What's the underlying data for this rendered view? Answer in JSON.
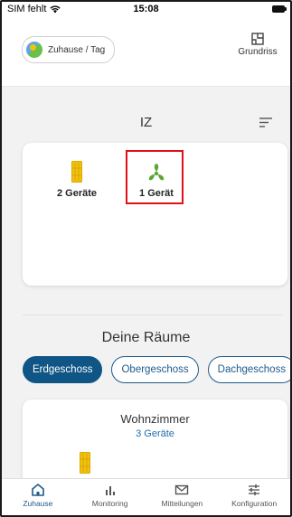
{
  "status": {
    "carrier": "SIM fehlt",
    "time": "15:08"
  },
  "header": {
    "home_label": "Zuhause / Tag",
    "grundriss_label": "Grundriss"
  },
  "area": {
    "title": "IZ"
  },
  "devices": [
    {
      "label": "2 Geräte",
      "icon": "heater-icon",
      "color": "#f2c10f"
    },
    {
      "label": "1 Gerät",
      "icon": "fan-icon",
      "color": "#5aa832"
    }
  ],
  "rooms": {
    "title": "Deine Räume",
    "tabs": [
      "Erdgeschoss",
      "Obergeschoss",
      "Dachgeschoss"
    ],
    "active_tab": "Erdgeschoss",
    "card": {
      "name": "Wohnzimmer",
      "count": "3 Geräte"
    }
  },
  "nav": [
    {
      "label": "Zuhause",
      "icon": "home-icon",
      "active": true
    },
    {
      "label": "Monitoring",
      "icon": "bar-chart-icon",
      "active": false
    },
    {
      "label": "Mitteilungen",
      "icon": "mail-icon",
      "active": false
    },
    {
      "label": "Konfiguration",
      "icon": "sliders-icon",
      "active": false
    }
  ],
  "colors": {
    "accent": "#0f5585",
    "link": "#1e6fb0",
    "highlight": "#e0101a"
  }
}
